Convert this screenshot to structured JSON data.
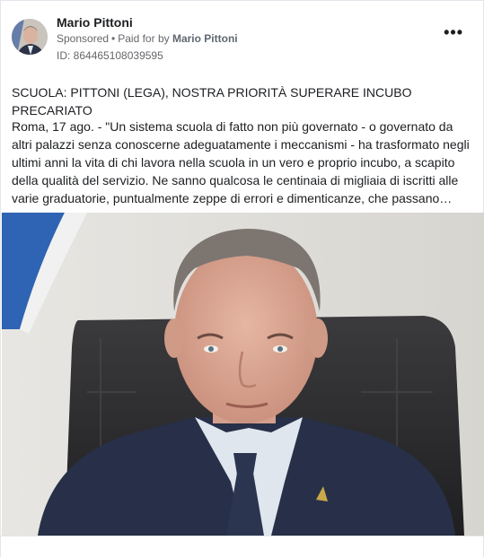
{
  "post": {
    "author": "Mario Pittoni",
    "sponsored": "Sponsored",
    "paid_prefix": "Paid for by",
    "paid_by": "Mario Pittoni",
    "ad_id": "ID: 864465108039595",
    "more_label": "•••",
    "headline": "SCUOLA: PITTONI (LEGA), NOSTRA PRIORITÀ SUPERARE INCUBO PRECARIATO",
    "body": "Roma, 17 ago. - \"Un sistema scuola di fatto non più governato - o governato da altri palazzi senza conoscerne adeguatamente i meccanismi - ha trasformato negli ultimi anni la vita di chi lavora nella scuola in un vero e proprio incubo, a scapito della qualità del servizio. Ne sanno qualcosa le centinaia di migliaia di iscritti alle varie graduatorie, puntualmente zeppe di errori e dimenticanze, che passano…"
  },
  "icons": {
    "more": "more-options-icon",
    "avatar": "profile-photo"
  },
  "colors": {
    "text": "#1c1e21",
    "secondary": "#65676b",
    "border": "#e4e6eb"
  }
}
